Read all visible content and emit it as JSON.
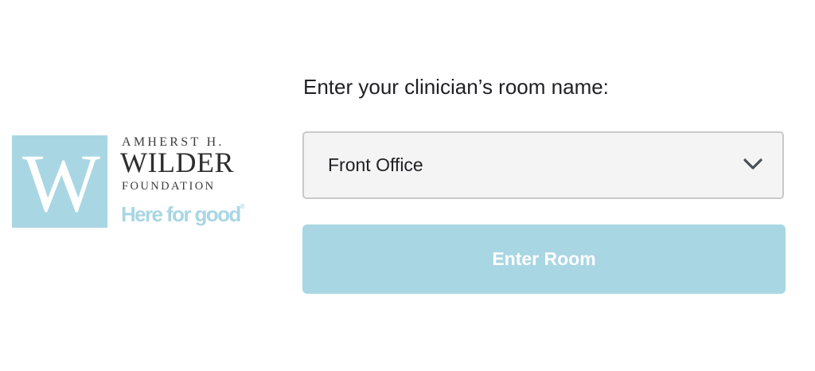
{
  "logo": {
    "mark_letter": "W",
    "line1": "AMHERST H.",
    "line2": "WILDER",
    "line3": "FOUNDATION",
    "tagline": "Here for good",
    "tagline_mark": "®",
    "brand_color": "#a9d6e3"
  },
  "form": {
    "prompt": "Enter your clinician’s room name:",
    "room_select": {
      "value": "Front Office",
      "icon": "chevron-down-icon"
    },
    "enter_button": {
      "label": "Enter Room",
      "color": "#a9d6e3"
    }
  }
}
